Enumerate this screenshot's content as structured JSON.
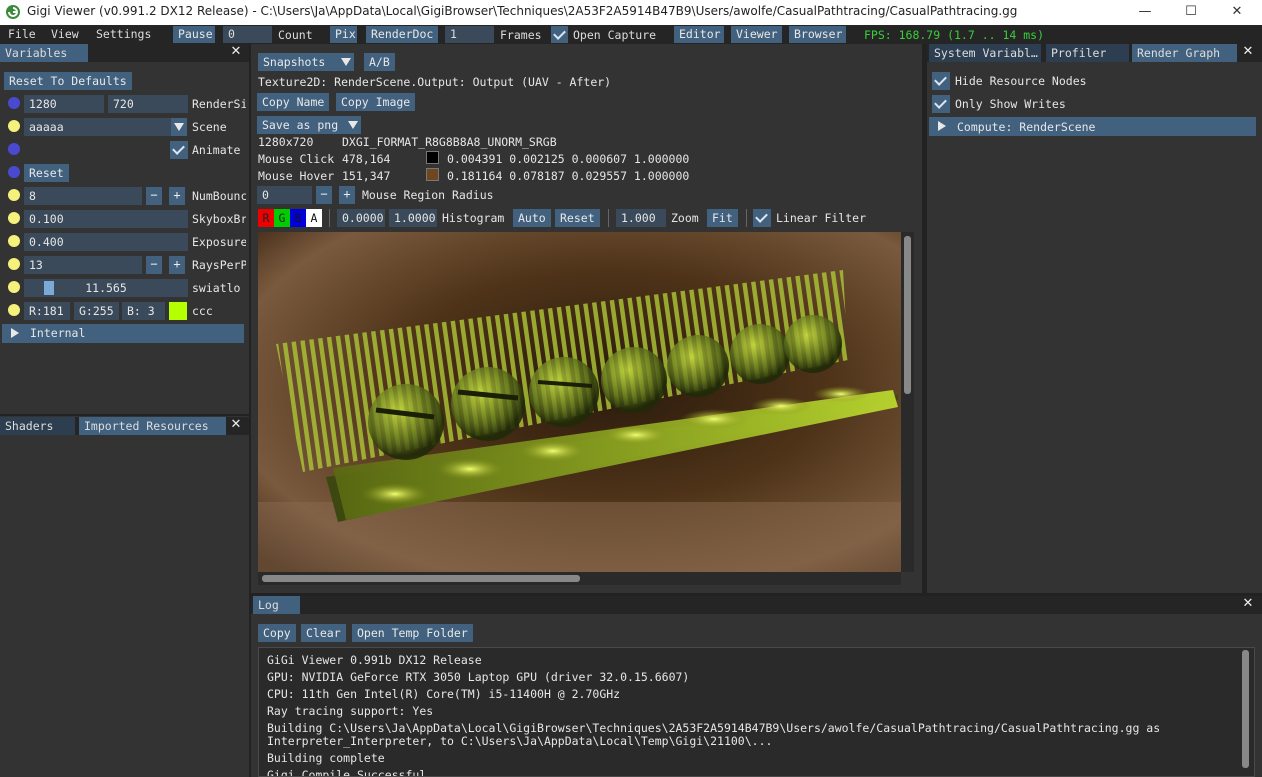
{
  "window": {
    "title": "Gigi Viewer (v0.991.2 DX12 Release) - C:\\Users\\Ja\\AppData\\Local\\GigiBrowser\\Techniques\\2A53F2A5914B47B9\\Users/awolfe/CasualPathtracing/CasualPathtracing.gg"
  },
  "menubar": {
    "file": "File",
    "view": "View",
    "settings": "Settings",
    "pause": "Pause",
    "count_value": "0",
    "count_label": "Count",
    "pix": "Pix",
    "renderdoc": "RenderDoc",
    "frames_value": "1",
    "frames_label": "Frames",
    "open_capture": "Open Capture",
    "editor": "Editor",
    "viewer": "Viewer",
    "browser": "Browser",
    "fps": "FPS: 168.79 (1.7 .. 14 ms)"
  },
  "variables": {
    "tab": "Variables",
    "reset_defaults": "Reset To Defaults",
    "render_w": "1280",
    "render_h": "720",
    "render_label": "RenderSize",
    "scene_value": "aaaaa",
    "scene_label": "Scene",
    "animate_label": "Animate",
    "reset": "Reset",
    "bounces_value": "8",
    "bounces_label": "NumBounces",
    "skybox_value": "0.100",
    "skybox_label": "SkyboxBrightness",
    "exposure_value": "0.400",
    "exposure_label": "Exposure",
    "rays_value": "13",
    "rays_label": "RaysPerPixel",
    "swiat_value": "11.565",
    "swiat_label": "swiatlo",
    "color_r": "R:181",
    "color_g": "G:255",
    "color_b": "B:  3",
    "color_label": "ccc",
    "internal": "Internal",
    "minus": "−",
    "plus": "+"
  },
  "bottom_left": {
    "shaders": "Shaders",
    "imported": "Imported Resources"
  },
  "viewer": {
    "snapshots": "Snapshots",
    "ab": "A/B",
    "texture": "Texture2D: RenderScene.Output: Output (UAV - After)",
    "copy_name": "Copy Name",
    "copy_image": "Copy Image",
    "save_png": "Save as png",
    "size": "1280x720",
    "format": "DXGI_FORMAT_R8G8B8A8_UNORM_SRGB",
    "click_label": "Mouse Click",
    "click_pos": "478,164",
    "click_val": "0.004391 0.002125 0.000607 1.000000",
    "hover_label": "Mouse Hover",
    "hover_pos": "151,347",
    "hover_val": "0.181164 0.078187 0.029557 1.000000",
    "radius_value": "0",
    "radius_label": "Mouse Region Radius",
    "ch_r": "R",
    "ch_g": "G",
    "ch_b": "B",
    "ch_a": "A",
    "hmin": "0.0000",
    "hmax": "1.0000",
    "histogram": "Histogram",
    "auto": "Auto",
    "reset": "Reset",
    "zoom_value": "1.000",
    "zoom": "Zoom",
    "fit": "Fit",
    "linear": "Linear Filter"
  },
  "right": {
    "tab_sys": "System Variabl…",
    "tab_prof": "Profiler",
    "tab_graph": "Render Graph",
    "hide_nodes": "Hide Resource Nodes",
    "only_writes": "Only Show Writes",
    "compute": "Compute: RenderScene"
  },
  "log": {
    "tab": "Log",
    "copy": "Copy",
    "clear": "Clear",
    "open_temp": "Open Temp Folder",
    "lines": [
      "GiGi Viewer 0.991b DX12 Release",
      "GPU: NVIDIA GeForce RTX 3050 Laptop GPU (driver 32.0.15.6607)",
      "CPU: 11th Gen Intel(R) Core(TM) i5-11400H @ 2.70GHz",
      "Ray tracing support: Yes",
      "Building C:\\Users\\Ja\\AppData\\Local\\GigiBrowser\\Techniques\\2A53F2A5914B47B9\\Users/awolfe/CasualPathtracing/CasualPathtracing.gg as",
      "Interpreter_Interpreter, to C:\\Users\\Ja\\AppData\\Local\\Temp\\Gigi\\21100\\...",
      "Building complete",
      "Gigi Compile Successful"
    ]
  },
  "colors": {
    "accent": "#41617f",
    "swatch": "#b5ff03",
    "fps": "#38d038"
  }
}
